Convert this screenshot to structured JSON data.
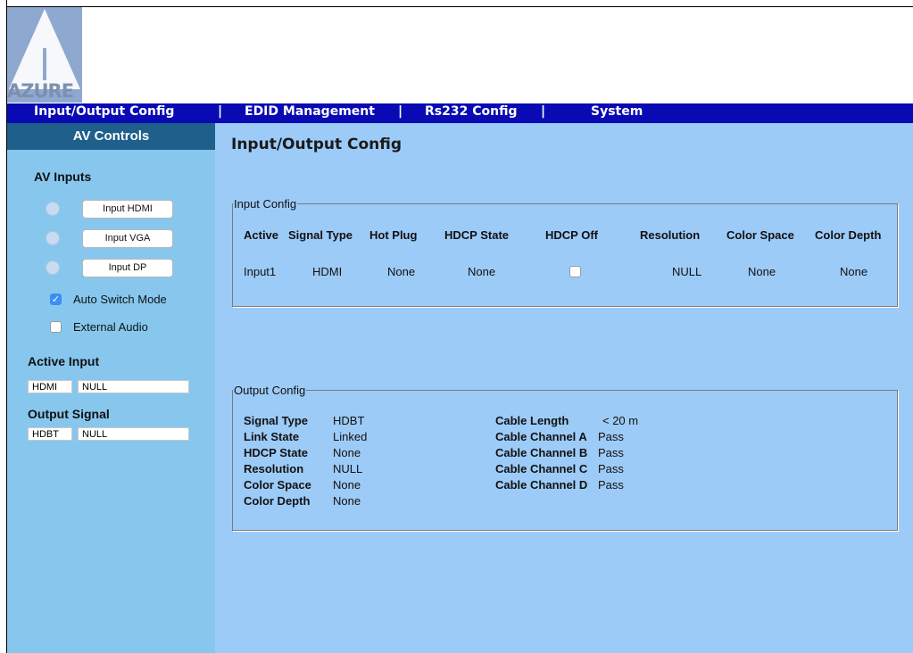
{
  "brand": {
    "logo_text": "AZURE"
  },
  "nav": {
    "items": [
      "Input/Output Config",
      "EDID Management",
      "Rs232 Config",
      "System"
    ],
    "separator": "|"
  },
  "sidebar": {
    "header": "AV Controls",
    "av_inputs_title": "AV Inputs",
    "inputs": [
      "Input HDMI",
      "Input VGA",
      "Input DP"
    ],
    "auto_switch_label": "Auto Switch Mode",
    "auto_switch_checked": true,
    "external_audio_label": "External Audio",
    "external_audio_checked": false,
    "active_input_title": "Active Input",
    "active_input_type": "HDMI",
    "active_input_value": "NULL",
    "output_signal_title": "Output Signal",
    "output_signal_type": "HDBT",
    "output_signal_value": "NULL"
  },
  "main": {
    "title": "Input/Output Config",
    "input_config": {
      "legend": "Input Config",
      "headers": [
        "Active",
        "Signal Type",
        "Hot Plug",
        "HDCP State",
        "HDCP Off",
        "Resolution",
        "Color Space",
        "Color Depth"
      ],
      "row": {
        "active": "Input1",
        "signal_type": "HDMI",
        "hot_plug": "None",
        "hdcp_state": "None",
        "hdcp_off_checked": false,
        "resolution": "NULL",
        "color_space": "None",
        "color_depth": "None"
      }
    },
    "output_config": {
      "legend": "Output Config",
      "left": [
        {
          "label": "Signal Type",
          "value": "HDBT"
        },
        {
          "label": "Link State",
          "value": "Linked"
        },
        {
          "label": "HDCP State",
          "value": "None"
        },
        {
          "label": "Resolution",
          "value": "NULL"
        },
        {
          "label": "Color Space",
          "value": "None"
        },
        {
          "label": "Color Depth",
          "value": "None"
        }
      ],
      "right": [
        {
          "label": "Cable Length",
          "value": "< 20 m"
        },
        {
          "label": "Cable Channel A",
          "value": "Pass"
        },
        {
          "label": "Cable Channel B",
          "value": "Pass"
        },
        {
          "label": "Cable Channel C",
          "value": "Pass"
        },
        {
          "label": "Cable Channel D",
          "value": "Pass"
        }
      ]
    }
  },
  "colors": {
    "nav_bg": "#0a0ab4",
    "sidebar_bg": "#87c7ee",
    "sidebar_header_bg": "#1f5f8b",
    "main_bg": "#9dcbf8",
    "checkbox_on": "#3d8ef2"
  }
}
